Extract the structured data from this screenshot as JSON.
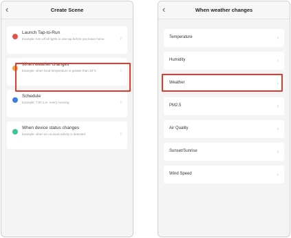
{
  "left_screen": {
    "title": "Create Scene",
    "back_icon": "chevron-left-icon",
    "options": [
      {
        "title": "Launch Tap-to-Run",
        "subtitle": "Example: turn off all lights in one tap before you leave home",
        "icon": "tap-icon",
        "icon_color": "#e0524a"
      },
      {
        "title": "When weather changes",
        "subtitle": "Example: when local temperature is greater than 28°C",
        "icon": "sun-icon",
        "icon_color": "#f0a23a"
      },
      {
        "title": "Schedule",
        "subtitle": "Example: 7:00 a.m. every morning",
        "icon": "clock-icon",
        "icon_color": "#3d7fe0"
      },
      {
        "title": "When device status changes",
        "subtitle": "Example: when an unusual activity is detected",
        "icon": "device-icon",
        "icon_color": "#3fc49a"
      }
    ]
  },
  "right_screen": {
    "title": "When weather changes",
    "back_icon": "chevron-left-icon",
    "items": [
      {
        "label": "Temperature"
      },
      {
        "label": "Humidity"
      },
      {
        "label": "Weather"
      },
      {
        "label": "PM2.5"
      },
      {
        "label": "Air Quality"
      },
      {
        "label": "Sunset/Sunrise"
      },
      {
        "label": "Wind Speed"
      }
    ]
  },
  "colors": {
    "highlight": "#e03a2e"
  }
}
